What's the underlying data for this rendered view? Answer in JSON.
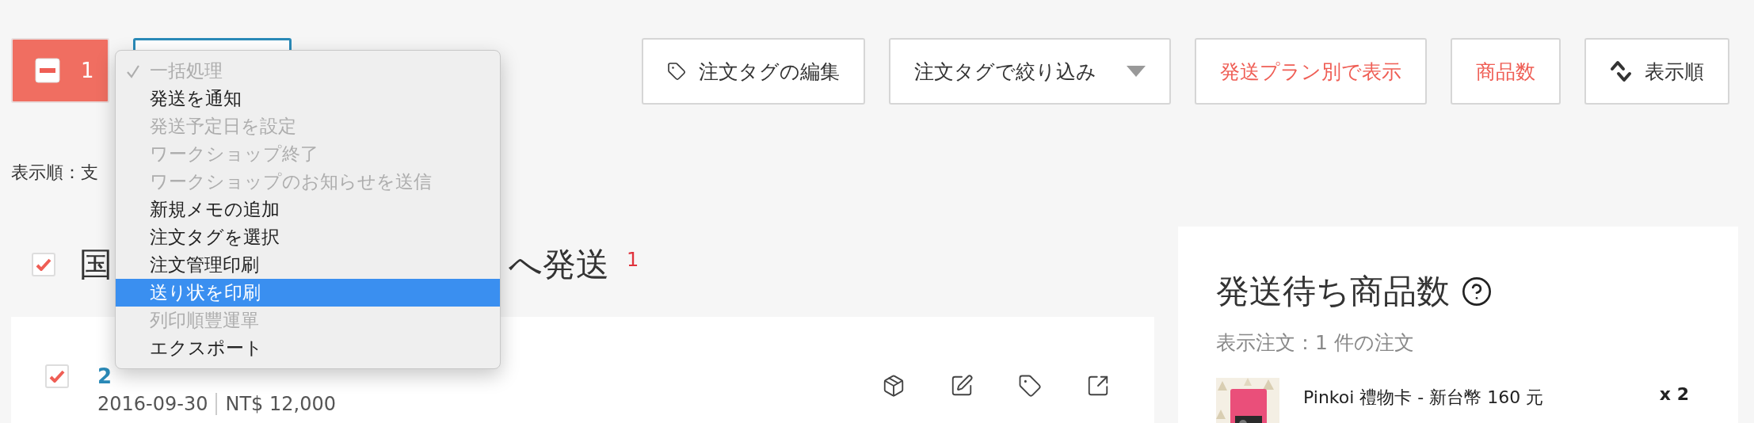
{
  "bulk_bar": {
    "selection_count": "1",
    "select_box_open": true
  },
  "bulk_menu": [
    {
      "label": "一括処理",
      "checked": true,
      "disabled": true,
      "selected": false
    },
    {
      "label": "発送を通知",
      "checked": false,
      "disabled": false,
      "selected": false
    },
    {
      "label": "発送予定日を設定",
      "checked": false,
      "disabled": true,
      "selected": false
    },
    {
      "label": "ワークショップ終了",
      "checked": false,
      "disabled": true,
      "selected": false
    },
    {
      "label": "ワークショップのお知らせを送信",
      "checked": false,
      "disabled": true,
      "selected": false
    },
    {
      "label": "新規メモの追加",
      "checked": false,
      "disabled": false,
      "selected": false
    },
    {
      "label": "注文タグを選択",
      "checked": false,
      "disabled": false,
      "selected": false
    },
    {
      "label": "注文管理印刷",
      "checked": false,
      "disabled": false,
      "selected": false
    },
    {
      "label": "送り状を印刷",
      "checked": false,
      "disabled": false,
      "selected": true
    },
    {
      "label": "列印順豐運單",
      "checked": false,
      "disabled": true,
      "selected": false
    },
    {
      "label": "エクスポート",
      "checked": false,
      "disabled": false,
      "selected": false
    }
  ],
  "toolbar_buttons": [
    {
      "kind": "tag",
      "label": "注文タグの編集"
    },
    {
      "kind": "dropdown",
      "label": "注文タグで絞り込み"
    },
    {
      "kind": "accent",
      "label": "発送プラン別で表示"
    },
    {
      "kind": "accent",
      "label": "商品数"
    },
    {
      "kind": "sort",
      "label": "表示順"
    }
  ],
  "sort_label": "表示順：支",
  "group": {
    "checked": true,
    "title_start": "国",
    "title_end": "へ発送",
    "count": "1"
  },
  "order": {
    "checked": true,
    "number": "2",
    "date": "2016-09-30",
    "total": "NT$ 12,000"
  },
  "pending_panel": {
    "title": "発送待ち商品数",
    "subtitle": "表示注文：1 件の注文",
    "items": [
      {
        "kind": "picture",
        "name": "Pinkoi 禮物卡 - 新台幣 160 元",
        "quantity": "x 2"
      }
    ]
  }
}
